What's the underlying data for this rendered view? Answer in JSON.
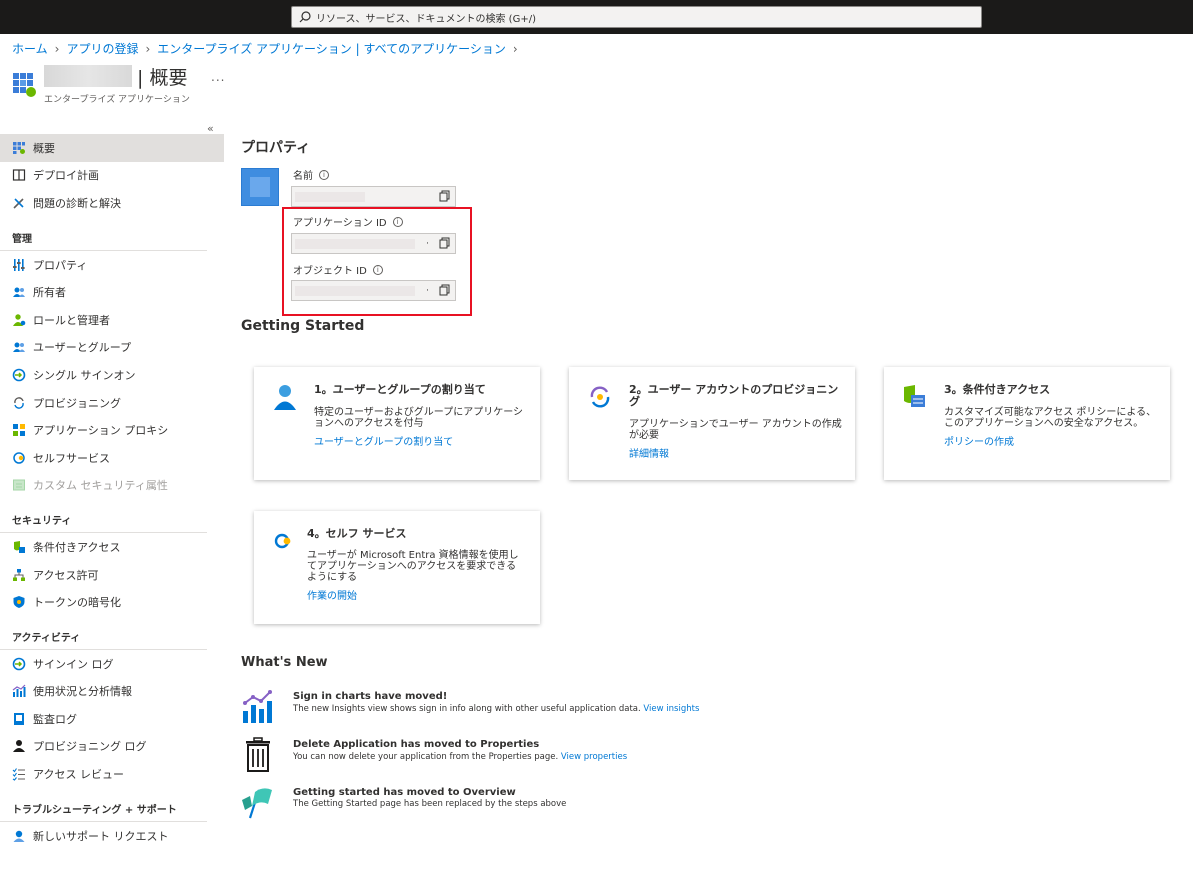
{
  "search": {
    "placeholder": "リソース、サービス、ドキュメントの検索 (G+/)"
  },
  "breadcrumb": [
    "ホーム",
    "アプリの登録",
    "エンタープライズ アプリケーション | すべてのアプリケーション"
  ],
  "header": {
    "title": "| 概要",
    "subtitle": "エンタープライズ アプリケーション",
    "more": "..."
  },
  "sidebar": {
    "collapse": "«",
    "items_top": [
      {
        "label": "概要",
        "icon": "grid-icon",
        "active": true
      },
      {
        "label": "デプロイ計画",
        "icon": "book-icon"
      },
      {
        "label": "問題の診断と解決",
        "icon": "wrench-icon"
      }
    ],
    "sections": [
      {
        "title": "管理",
        "items": [
          {
            "label": "プロパティ",
            "icon": "properties-icon"
          },
          {
            "label": "所有者",
            "icon": "owners-icon"
          },
          {
            "label": "ロールと管理者",
            "icon": "roles-icon"
          },
          {
            "label": "ユーザーとグループ",
            "icon": "users-groups-icon"
          },
          {
            "label": "シングル サインオン",
            "icon": "sso-icon"
          },
          {
            "label": "プロビジョニング",
            "icon": "provisioning-icon"
          },
          {
            "label": "アプリケーション プロキシ",
            "icon": "app-proxy-icon"
          },
          {
            "label": "セルフサービス",
            "icon": "self-service-icon"
          },
          {
            "label": "カスタム セキュリティ属性",
            "icon": "custom-attributes-icon",
            "disabled": true
          }
        ]
      },
      {
        "title": "セキュリティ",
        "items": [
          {
            "label": "条件付きアクセス",
            "icon": "conditional-access-icon"
          },
          {
            "label": "アクセス許可",
            "icon": "permissions-icon"
          },
          {
            "label": "トークンの暗号化",
            "icon": "token-encryption-icon"
          }
        ]
      },
      {
        "title": "アクティビティ",
        "items": [
          {
            "label": "サインイン ログ",
            "icon": "signin-logs-icon"
          },
          {
            "label": "使用状況と分析情報",
            "icon": "usage-insights-icon"
          },
          {
            "label": "監査ログ",
            "icon": "audit-logs-icon"
          },
          {
            "label": "プロビジョニング ログ",
            "icon": "provisioning-logs-icon"
          },
          {
            "label": "アクセス レビュー",
            "icon": "access-reviews-icon"
          }
        ]
      },
      {
        "title": "トラブルシューティング + サポート",
        "items": [
          {
            "label": "新しいサポート リクエスト",
            "icon": "support-request-icon"
          }
        ]
      }
    ]
  },
  "properties": {
    "heading": "プロパティ",
    "name_label": "名前",
    "app_id_label": "アプリケーション ID",
    "object_id_label": "オブジェクト ID",
    "dot": "·"
  },
  "getting_started": {
    "heading": "Getting Started",
    "cards": [
      {
        "title": "1。ユーザーとグループの割り当て",
        "desc": "特定のユーザーおよびグループにアプリケーションへのアクセスを付与",
        "link": "ユーザーとグループの割り当て",
        "icon": "user-assign-icon"
      },
      {
        "title": "2。ユーザー アカウントのプロビジョニング",
        "desc": "アプリケーションでユーザー アカウントの作成が必要",
        "link": "詳細情報",
        "icon": "provisioning-sync-icon"
      },
      {
        "title": "3。条件付きアクセス",
        "desc": "カスタマイズ可能なアクセス ポリシーによる、このアプリケーションへの安全なアクセス。",
        "link": "ポリシーの作成",
        "icon": "shield-policy-icon"
      },
      {
        "title": "4。セルフ サービス",
        "desc": "ユーザーが Microsoft Entra 資格情報を使用してアプリケーションへのアクセスを要求できるようにする",
        "link": "作業の開始",
        "icon": "self-service-key-icon"
      }
    ]
  },
  "whats_new": {
    "heading": "What's New",
    "items": [
      {
        "title": "Sign in charts have moved!",
        "desc": "The new Insights view shows sign in info along with other useful application data.",
        "link": "View insights",
        "icon": "chart-icon"
      },
      {
        "title": "Delete Application has moved to Properties",
        "desc": "You can now delete your application from the Properties page.",
        "link": "View properties",
        "icon": "trash-icon"
      },
      {
        "title": "Getting started has moved to Overview",
        "desc": "The Getting Started page has been replaced by the steps above",
        "link": "",
        "icon": "flag-icon"
      }
    ]
  },
  "colors": {
    "accent": "#0078d4",
    "highlight": "#e81123",
    "topbar": "#1b1a19"
  }
}
